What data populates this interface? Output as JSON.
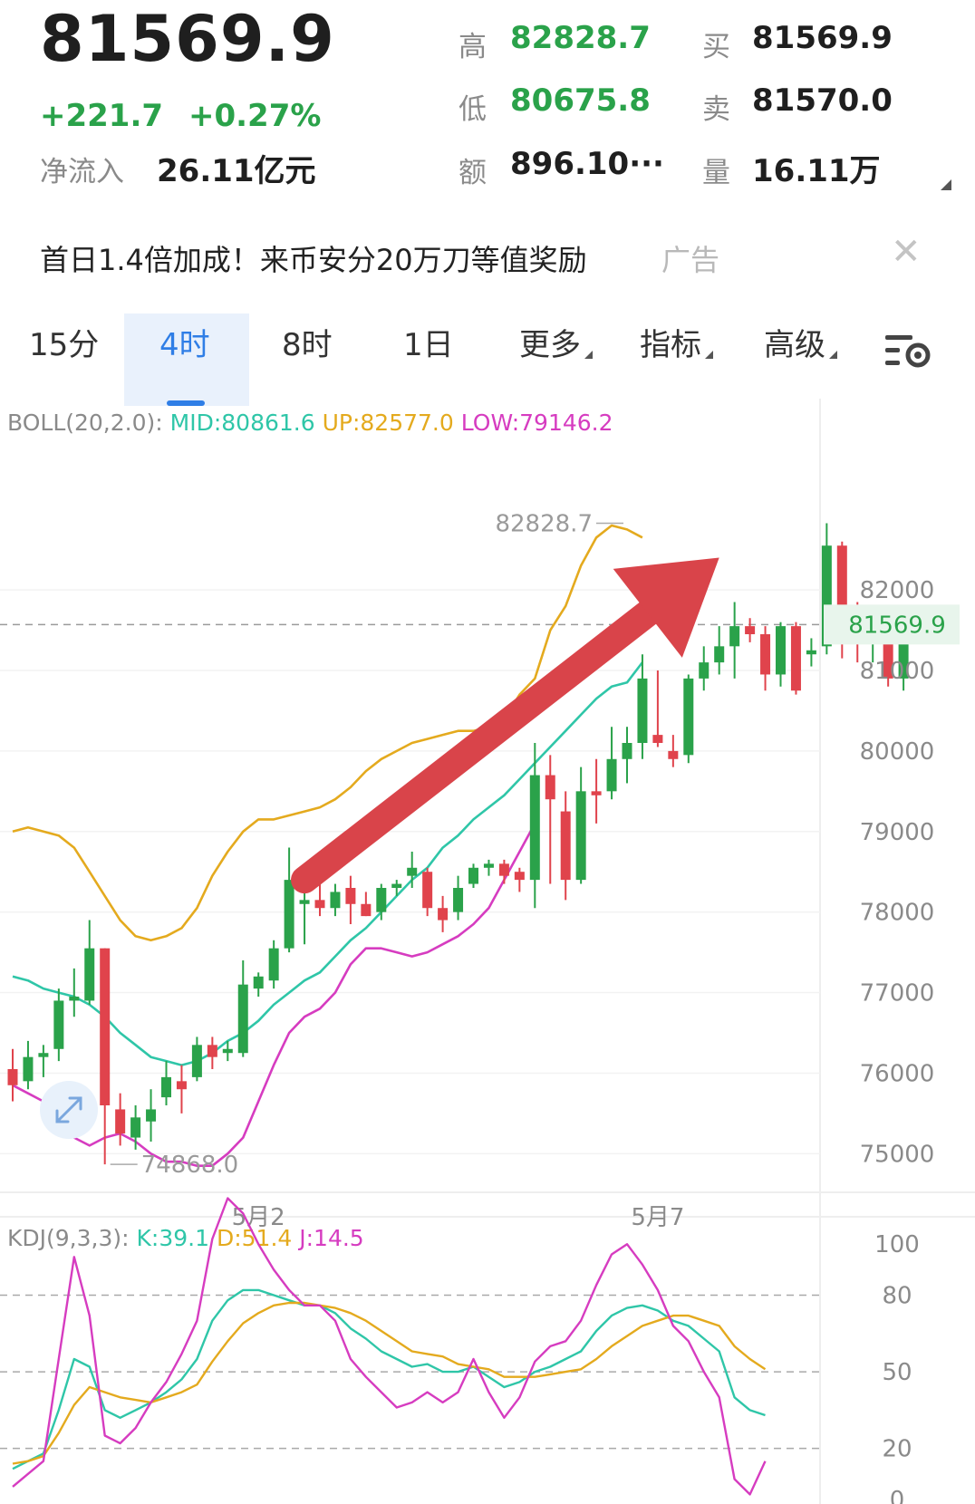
{
  "quote": {
    "price": "81569.9",
    "change": "+221.7",
    "change_pct": "+0.27%",
    "net_inflow_label": "净流入",
    "net_inflow_value": "26.11亿元",
    "high_label": "高",
    "high_value": "82828.7",
    "low_label": "低",
    "low_value": "80675.8",
    "amount_label": "额",
    "amount_value": "896.10···",
    "buy_label": "买",
    "buy_value": "81569.9",
    "sell_label": "卖",
    "sell_value": "81570.0",
    "volume_label": "量",
    "volume_value": "16.11万"
  },
  "ad": {
    "text": "首日1.4倍加成！来币安分20万刀等值奖励",
    "tag": "广告",
    "close": "✕"
  },
  "tabs": [
    {
      "label": "15分",
      "active": false
    },
    {
      "label": "4时",
      "active": true
    },
    {
      "label": "8时",
      "active": false
    },
    {
      "label": "1日",
      "active": false
    },
    {
      "label": "更多",
      "active": false,
      "dropdown": true
    },
    {
      "label": "指标",
      "active": false,
      "dropdown": true
    },
    {
      "label": "高级",
      "active": false,
      "dropdown": true
    }
  ],
  "colors": {
    "up": "#2aa24a",
    "down": "#e0434c",
    "mid": "#2fc6a8",
    "upper": "#e4aa1e",
    "lower": "#d63cc0",
    "arrow": "#d9444a",
    "accent": "#2f7ee6"
  },
  "chart_data": [
    {
      "type": "candlestick",
      "indicator": "BOLL(20,2.0)",
      "legend": {
        "name": "BOLL(20,2.0):",
        "mid": "MID:80861.6",
        "up": "UP:82577.0",
        "low": "LOW:79146.2"
      },
      "ylim": [
        74700,
        83700
      ],
      "yticks": [
        "82000",
        "81000",
        "80000",
        "79000",
        "78000",
        "77000",
        "76000",
        "75000"
      ],
      "ytick_values": [
        82000,
        81000,
        80000,
        79000,
        78000,
        77000,
        76000,
        75000
      ],
      "current_price_label": "81569.9",
      "current_price": 81569.9,
      "high_marker": {
        "label": "82828.7",
        "value": 82828.7,
        "candle_index": 40
      },
      "low_marker": {
        "label": "74868.0",
        "value": 74868.0,
        "candle_index": 6
      },
      "x_labels": [
        {
          "label": "5月2",
          "candle_index": 16
        },
        {
          "label": "5月7",
          "candle_index": 42
        }
      ],
      "candles": [
        {
          "o": 76050,
          "h": 76300,
          "l": 75650,
          "c": 75850
        },
        {
          "o": 75900,
          "h": 76400,
          "l": 75800,
          "c": 76200
        },
        {
          "o": 76200,
          "h": 76350,
          "l": 75950,
          "c": 76250
        },
        {
          "o": 76300,
          "h": 77050,
          "l": 76150,
          "c": 76900
        },
        {
          "o": 76900,
          "h": 77300,
          "l": 76700,
          "c": 76950
        },
        {
          "o": 76900,
          "h": 77900,
          "l": 76850,
          "c": 77550
        },
        {
          "o": 77550,
          "h": 77550,
          "l": 74868,
          "c": 75600
        },
        {
          "o": 75550,
          "h": 75750,
          "l": 75100,
          "c": 75250
        },
        {
          "o": 75200,
          "h": 75600,
          "l": 75050,
          "c": 75450
        },
        {
          "o": 75400,
          "h": 75800,
          "l": 75150,
          "c": 75550
        },
        {
          "o": 75700,
          "h": 76150,
          "l": 75600,
          "c": 75950
        },
        {
          "o": 75900,
          "h": 76100,
          "l": 75500,
          "c": 75800
        },
        {
          "o": 75950,
          "h": 76450,
          "l": 75900,
          "c": 76350
        },
        {
          "o": 76350,
          "h": 76450,
          "l": 76050,
          "c": 76200
        },
        {
          "o": 76250,
          "h": 76400,
          "l": 76150,
          "c": 76300
        },
        {
          "o": 76250,
          "h": 77400,
          "l": 76200,
          "c": 77100
        },
        {
          "o": 77050,
          "h": 77250,
          "l": 76950,
          "c": 77200
        },
        {
          "o": 77150,
          "h": 77650,
          "l": 77050,
          "c": 77550
        },
        {
          "o": 77550,
          "h": 78800,
          "l": 77500,
          "c": 78400
        },
        {
          "o": 78100,
          "h": 78500,
          "l": 77600,
          "c": 78150
        },
        {
          "o": 78150,
          "h": 78350,
          "l": 77950,
          "c": 78050
        },
        {
          "o": 78050,
          "h": 78350,
          "l": 77950,
          "c": 78250
        },
        {
          "o": 78300,
          "h": 78450,
          "l": 77850,
          "c": 78100
        },
        {
          "o": 78100,
          "h": 78250,
          "l": 77950,
          "c": 77950
        },
        {
          "o": 78000,
          "h": 78350,
          "l": 77900,
          "c": 78300
        },
        {
          "o": 78300,
          "h": 78400,
          "l": 78200,
          "c": 78350
        },
        {
          "o": 78450,
          "h": 78750,
          "l": 78300,
          "c": 78550
        },
        {
          "o": 78500,
          "h": 78550,
          "l": 77950,
          "c": 78050
        },
        {
          "o": 78050,
          "h": 78200,
          "l": 77750,
          "c": 77900
        },
        {
          "o": 78000,
          "h": 78450,
          "l": 77900,
          "c": 78300
        },
        {
          "o": 78350,
          "h": 78600,
          "l": 78300,
          "c": 78550
        },
        {
          "o": 78550,
          "h": 78650,
          "l": 78450,
          "c": 78600
        },
        {
          "o": 78600,
          "h": 78650,
          "l": 78350,
          "c": 78450
        },
        {
          "o": 78500,
          "h": 78550,
          "l": 78250,
          "c": 78400
        },
        {
          "o": 78400,
          "h": 80100,
          "l": 78050,
          "c": 79700
        },
        {
          "o": 79700,
          "h": 79950,
          "l": 78350,
          "c": 79400
        },
        {
          "o": 79250,
          "h": 79500,
          "l": 78150,
          "c": 78400
        },
        {
          "o": 78400,
          "h": 79800,
          "l": 78350,
          "c": 79500
        },
        {
          "o": 79500,
          "h": 79900,
          "l": 79100,
          "c": 79450
        },
        {
          "o": 79500,
          "h": 80300,
          "l": 79400,
          "c": 79900
        },
        {
          "o": 79900,
          "h": 80300,
          "l": 79600,
          "c": 80100
        },
        {
          "o": 80100,
          "h": 81200,
          "l": 79900,
          "c": 80900
        },
        {
          "o": 80200,
          "h": 81000,
          "l": 80050,
          "c": 80100
        },
        {
          "o": 80000,
          "h": 80200,
          "l": 79800,
          "c": 79900
        },
        {
          "o": 79950,
          "h": 80950,
          "l": 79850,
          "c": 80900
        },
        {
          "o": 80900,
          "h": 81300,
          "l": 80750,
          "c": 81100
        },
        {
          "o": 81100,
          "h": 81550,
          "l": 80950,
          "c": 81300
        },
        {
          "o": 81300,
          "h": 81850,
          "l": 80900,
          "c": 81550
        },
        {
          "o": 81550,
          "h": 81650,
          "l": 81350,
          "c": 81450
        },
        {
          "o": 81450,
          "h": 81550,
          "l": 80750,
          "c": 80950
        },
        {
          "o": 80950,
          "h": 81600,
          "l": 80800,
          "c": 81550
        },
        {
          "o": 81550,
          "h": 81600,
          "l": 80700,
          "c": 80750
        },
        {
          "o": 81200,
          "h": 81400,
          "l": 81050,
          "c": 81250
        },
        {
          "o": 81300,
          "h": 82828.7,
          "l": 81200,
          "c": 82550
        },
        {
          "o": 82550,
          "h": 82600,
          "l": 81150,
          "c": 81750
        },
        {
          "o": 81750,
          "h": 81850,
          "l": 81100,
          "c": 81400
        },
        {
          "o": 81400,
          "h": 81650,
          "l": 81100,
          "c": 81450
        },
        {
          "o": 81450,
          "h": 81550,
          "l": 80800,
          "c": 80900
        },
        {
          "o": 80900,
          "h": 81650,
          "l": 80750,
          "c": 81569.9
        }
      ],
      "boll_up": [
        79000,
        79050,
        79000,
        78950,
        78800,
        78500,
        78200,
        77900,
        77700,
        77650,
        77700,
        77800,
        78050,
        78450,
        78750,
        79000,
        79150,
        79150,
        79200,
        79250,
        79300,
        79400,
        79550,
        79750,
        79900,
        80000,
        80100,
        80150,
        80200,
        80250,
        80250,
        80300,
        80400,
        80700,
        80900,
        81500,
        81800,
        82300,
        82650,
        82800,
        82750,
        82650
      ],
      "boll_mid": [
        77200,
        77150,
        77050,
        77000,
        76950,
        76850,
        76700,
        76500,
        76350,
        76200,
        76150,
        76100,
        76150,
        76250,
        76400,
        76500,
        76650,
        76850,
        77000,
        77150,
        77250,
        77450,
        77650,
        77800,
        78000,
        78200,
        78400,
        78550,
        78800,
        78950,
        79150,
        79300,
        79450,
        79650,
        79850,
        80050,
        80250,
        80450,
        80650,
        80800,
        80850,
        81100
      ],
      "boll_low": [
        75850,
        75750,
        75650,
        75450,
        75200,
        75100,
        75200,
        75250,
        75150,
        75000,
        74900,
        74900,
        74850,
        74850,
        75000,
        75200,
        75650,
        76100,
        76500,
        76700,
        76800,
        77000,
        77350,
        77550,
        77550,
        77500,
        77450,
        77500,
        77600,
        77700,
        77850,
        78050,
        78400,
        78750,
        79100
      ],
      "arrow": {
        "from_candle": 19,
        "from_value": 78400,
        "to_candle": 46,
        "to_value": 82400
      }
    },
    {
      "type": "line",
      "indicator": "KDJ(9,3,3)",
      "legend": {
        "name": "KDJ(9,3,3):",
        "k": "K:39.1",
        "d": "D:51.4",
        "j": "J:14.5"
      },
      "ylim": [
        0,
        110
      ],
      "yticks": [
        "100",
        "80",
        "50",
        "20",
        "0"
      ],
      "ytick_values": [
        100,
        80,
        50,
        20,
        0
      ],
      "series": [
        {
          "key": "k",
          "values": [
            12,
            15,
            18,
            35,
            55,
            52,
            35,
            32,
            35,
            38,
            42,
            47,
            55,
            70,
            78,
            82,
            82,
            80,
            78,
            76,
            76,
            73,
            67,
            63,
            58,
            55,
            52,
            53,
            50,
            50,
            52,
            48,
            44,
            46,
            50,
            52,
            55,
            58,
            66,
            72,
            75,
            76,
            74,
            70,
            68,
            63,
            58,
            40,
            35,
            33
          ]
        },
        {
          "key": "d",
          "values": [
            14,
            15,
            17,
            26,
            37,
            44,
            42,
            40,
            39,
            38,
            40,
            42,
            45,
            54,
            62,
            69,
            73,
            76,
            77,
            77,
            76,
            75,
            73,
            70,
            66,
            62,
            58,
            57,
            56,
            53,
            52,
            51,
            48,
            48,
            48,
            49,
            50,
            51,
            55,
            60,
            64,
            68,
            70,
            72,
            72,
            70,
            68,
            60,
            55,
            51
          ]
        },
        {
          "key": "j",
          "values": [
            5,
            10,
            15,
            55,
            95,
            72,
            25,
            22,
            28,
            38,
            46,
            57,
            70,
            102,
            118,
            112,
            100,
            90,
            82,
            76,
            76,
            70,
            55,
            48,
            42,
            36,
            38,
            42,
            38,
            42,
            55,
            42,
            32,
            40,
            54,
            60,
            62,
            70,
            84,
            96,
            100,
            92,
            82,
            68,
            62,
            50,
            40,
            8,
            2,
            15
          ]
        }
      ]
    }
  ]
}
